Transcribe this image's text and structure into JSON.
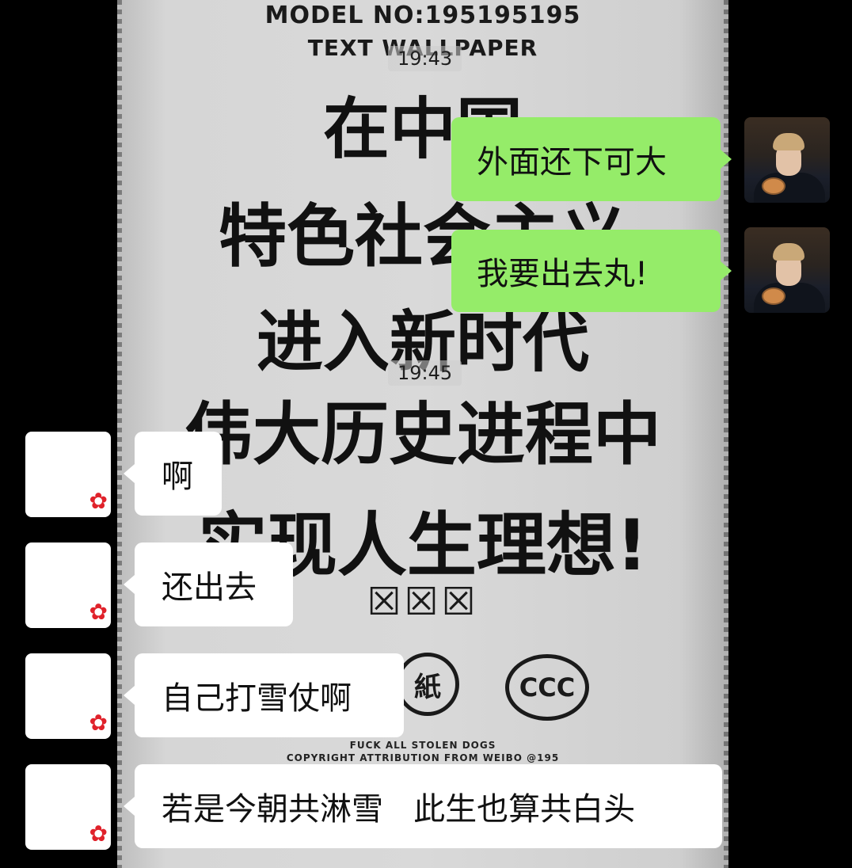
{
  "wallpaper": {
    "model": "MODEL NO:195195195",
    "subtitle": "TEXT WALLPAPER",
    "lines": [
      "在中国",
      "特色社会主义",
      "进入新时代",
      "伟大历史进程中",
      "实现人生理想!"
    ],
    "boxes": "☒☒☒",
    "logo_paper": "紙",
    "logo_ccc": "CCC",
    "fine_print_1": "FUCK ALL STOLEN DOGS",
    "fine_print_2": "COPYRIGHT ATTRIBUTION FROM WEIBO @195"
  },
  "chat": {
    "timestamps": [
      "19:43",
      "19:45"
    ],
    "messages": [
      {
        "side": "right",
        "text": "外面还下可大"
      },
      {
        "side": "right",
        "text": "我要出去丸!"
      },
      {
        "side": "left",
        "text": "啊"
      },
      {
        "side": "left",
        "text": "还出去"
      },
      {
        "side": "left",
        "text": "自己打雪仗啊"
      },
      {
        "side": "left",
        "text": "若是今朝共淋雪   此生也算共白头"
      }
    ],
    "self_avatar_icon": "user-photo-avatar",
    "other_avatar_icon": "red-flower-avatar",
    "colors": {
      "self_bubble": "#95ec69",
      "other_bubble": "#ffffff"
    }
  }
}
